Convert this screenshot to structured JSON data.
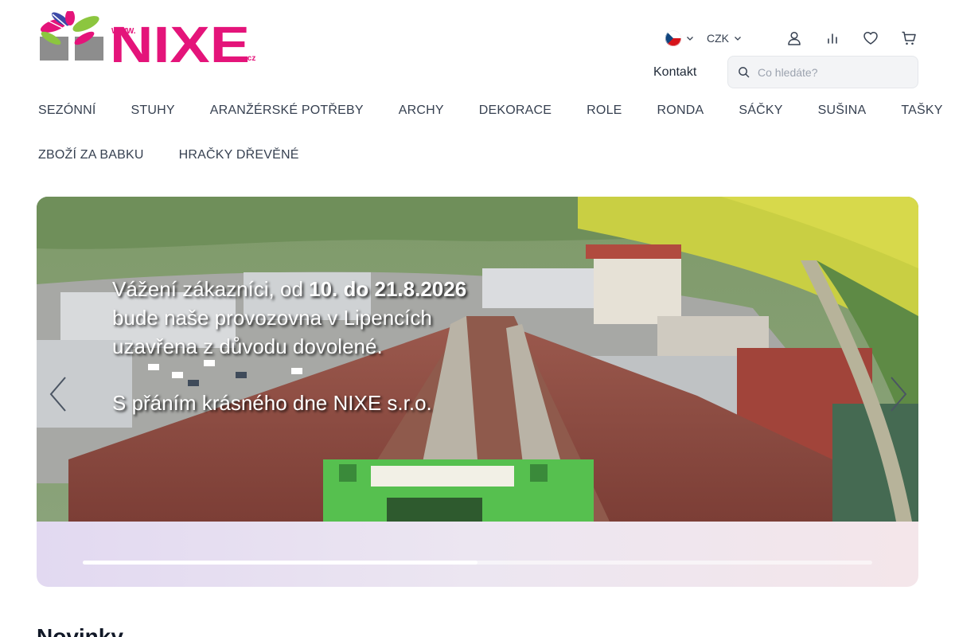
{
  "logo": {
    "www": "WWW.",
    "brand": "NIXE",
    "tld": ".cz"
  },
  "header": {
    "language": {
      "selected": "cs",
      "icon": "czech-flag-icon"
    },
    "currency": {
      "selected": "CZK"
    },
    "icons": [
      "user-icon",
      "compare-chart-icon",
      "heart-icon",
      "cart-icon"
    ],
    "contact_label": "Kontakt",
    "search_placeholder": "Co hledáte?"
  },
  "nav": {
    "row1": [
      "SEZÓNNÍ",
      "STUHY",
      "ARANŽÉRSKÉ POTŘEBY",
      "ARCHY",
      "DEKORACE",
      "ROLE",
      "RONDA",
      "SÁČKY",
      "SUŠINA",
      "TAŠKY"
    ],
    "row2": [
      "ZBOŽÍ ZA BABKU",
      "HRAČKY DŘEVĚNÉ"
    ]
  },
  "hero": {
    "line1_prefix": "Vážení zákazníci, od ",
    "line1_bold": "10. do 21.8.2026",
    "line2": "bude naše provozovna v Lipencích",
    "line3": "uzavřena z důvodu dovolené.",
    "line4": "S přáním krásného dne NIXE s.r.o.",
    "progress": 0.5
  },
  "section": {
    "title": "Novinky"
  },
  "colors": {
    "brand_pink": "#e4147a",
    "logo_gray": "#8d8d8d",
    "text": "#1f2937"
  }
}
